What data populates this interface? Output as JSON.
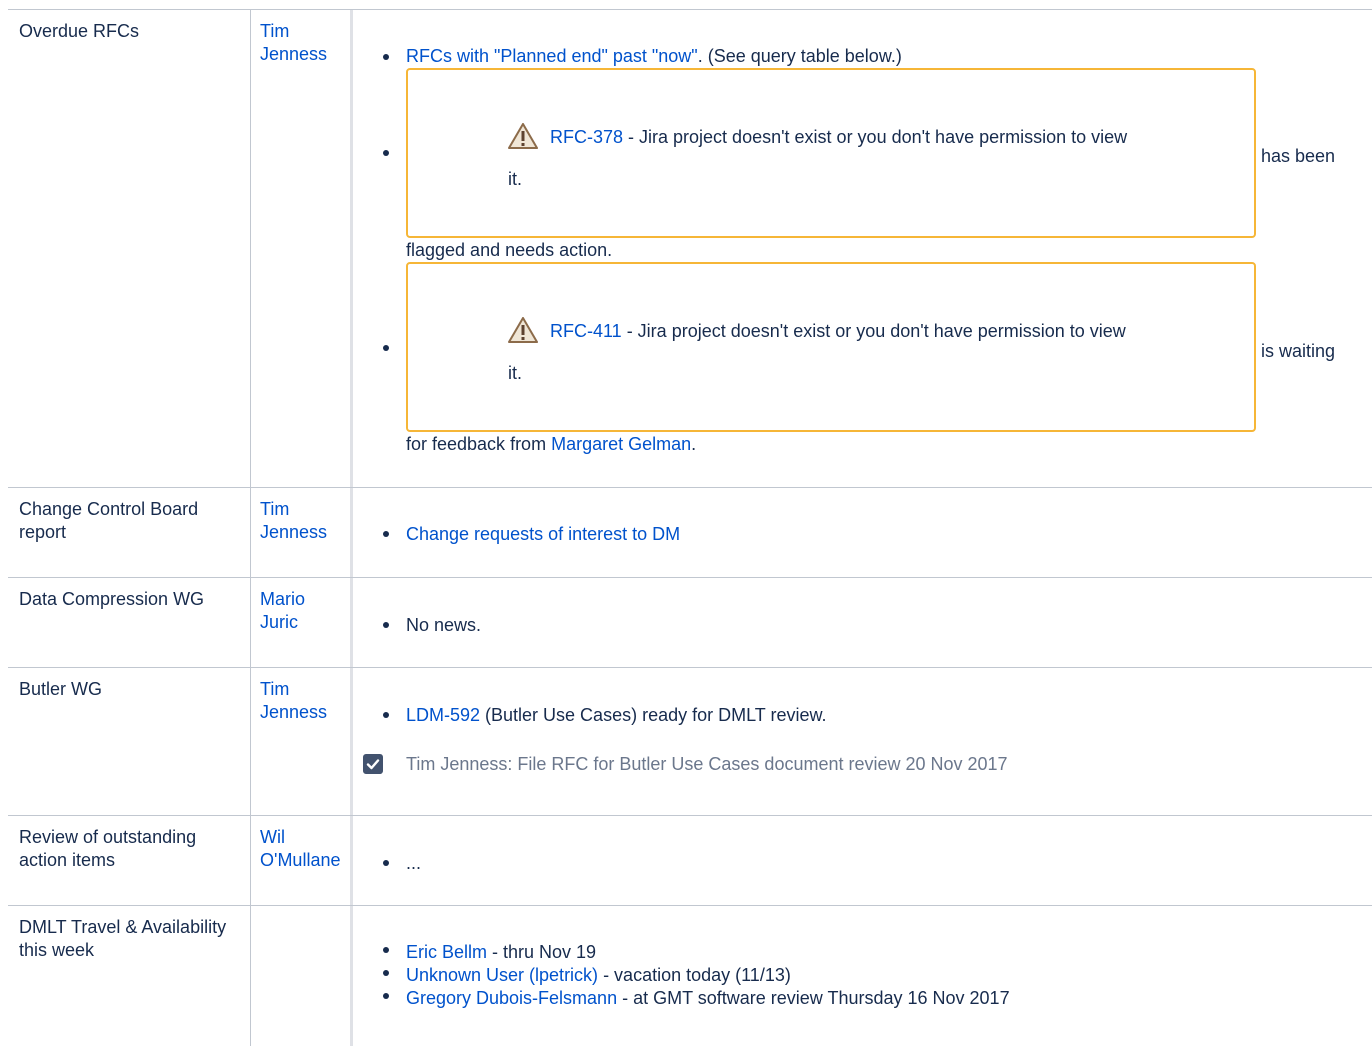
{
  "rows": [
    {
      "topic": "Overdue RFCs",
      "owner": [
        "Tim",
        "Jenness"
      ],
      "rfc_link": "RFCs with \"Planned end\" past \"now\"",
      "rfc_after": ". (See query table below.)",
      "jira1": {
        "key": "RFC-378",
        "msg": " - Jira project doesn't exist or you don't have permission to view",
        "msg2": "it.",
        "tail": "has been",
        "cont": "flagged and needs action."
      },
      "jira2": {
        "key": "RFC-411",
        "msg": " - Jira project doesn't exist or you don't have permission to view",
        "msg2": "it.",
        "tail": "is waiting",
        "cont_pre": "for feedback from ",
        "cont_link": "Margaret Gelman",
        "cont_post": "."
      }
    },
    {
      "topic": "Change Control Board report",
      "owner": [
        "Tim",
        "Jenness"
      ],
      "item": "Change requests of interest to DM"
    },
    {
      "topic": "Data Compression WG",
      "owner": [
        "Mario",
        "Juric"
      ],
      "item": "No news."
    },
    {
      "topic": "Butler WG",
      "owner": [
        "Tim",
        "Jenness"
      ],
      "item_link": "LDM-592",
      "item_after": " (Butler Use Cases) ready for DMLT review.",
      "task": "Tim Jenness: File RFC for Butler Use Cases document review 20 Nov 2017"
    },
    {
      "topic": "Review of outstanding action items",
      "owner": [
        "Wil",
        "O'Mullane"
      ],
      "item": "..."
    },
    {
      "topic": "DMLT Travel & Availability this week",
      "items": [
        {
          "link": "Eric Bellm",
          "after": " - thru Nov 19"
        },
        {
          "link": "Unknown User (lpetrick)",
          "after": " - vacation today (11/13)"
        },
        {
          "link": "Gregory Dubois-Felsmann",
          "after": " - at GMT software review Thursday 16 Nov 2017"
        }
      ]
    }
  ],
  "colors": {
    "link": "#0052cc",
    "warning_border": "#f6b637",
    "text": "#172b4d"
  },
  "icons": {
    "warning": "warning-icon",
    "checkbox": "checkbox-checked-icon"
  }
}
